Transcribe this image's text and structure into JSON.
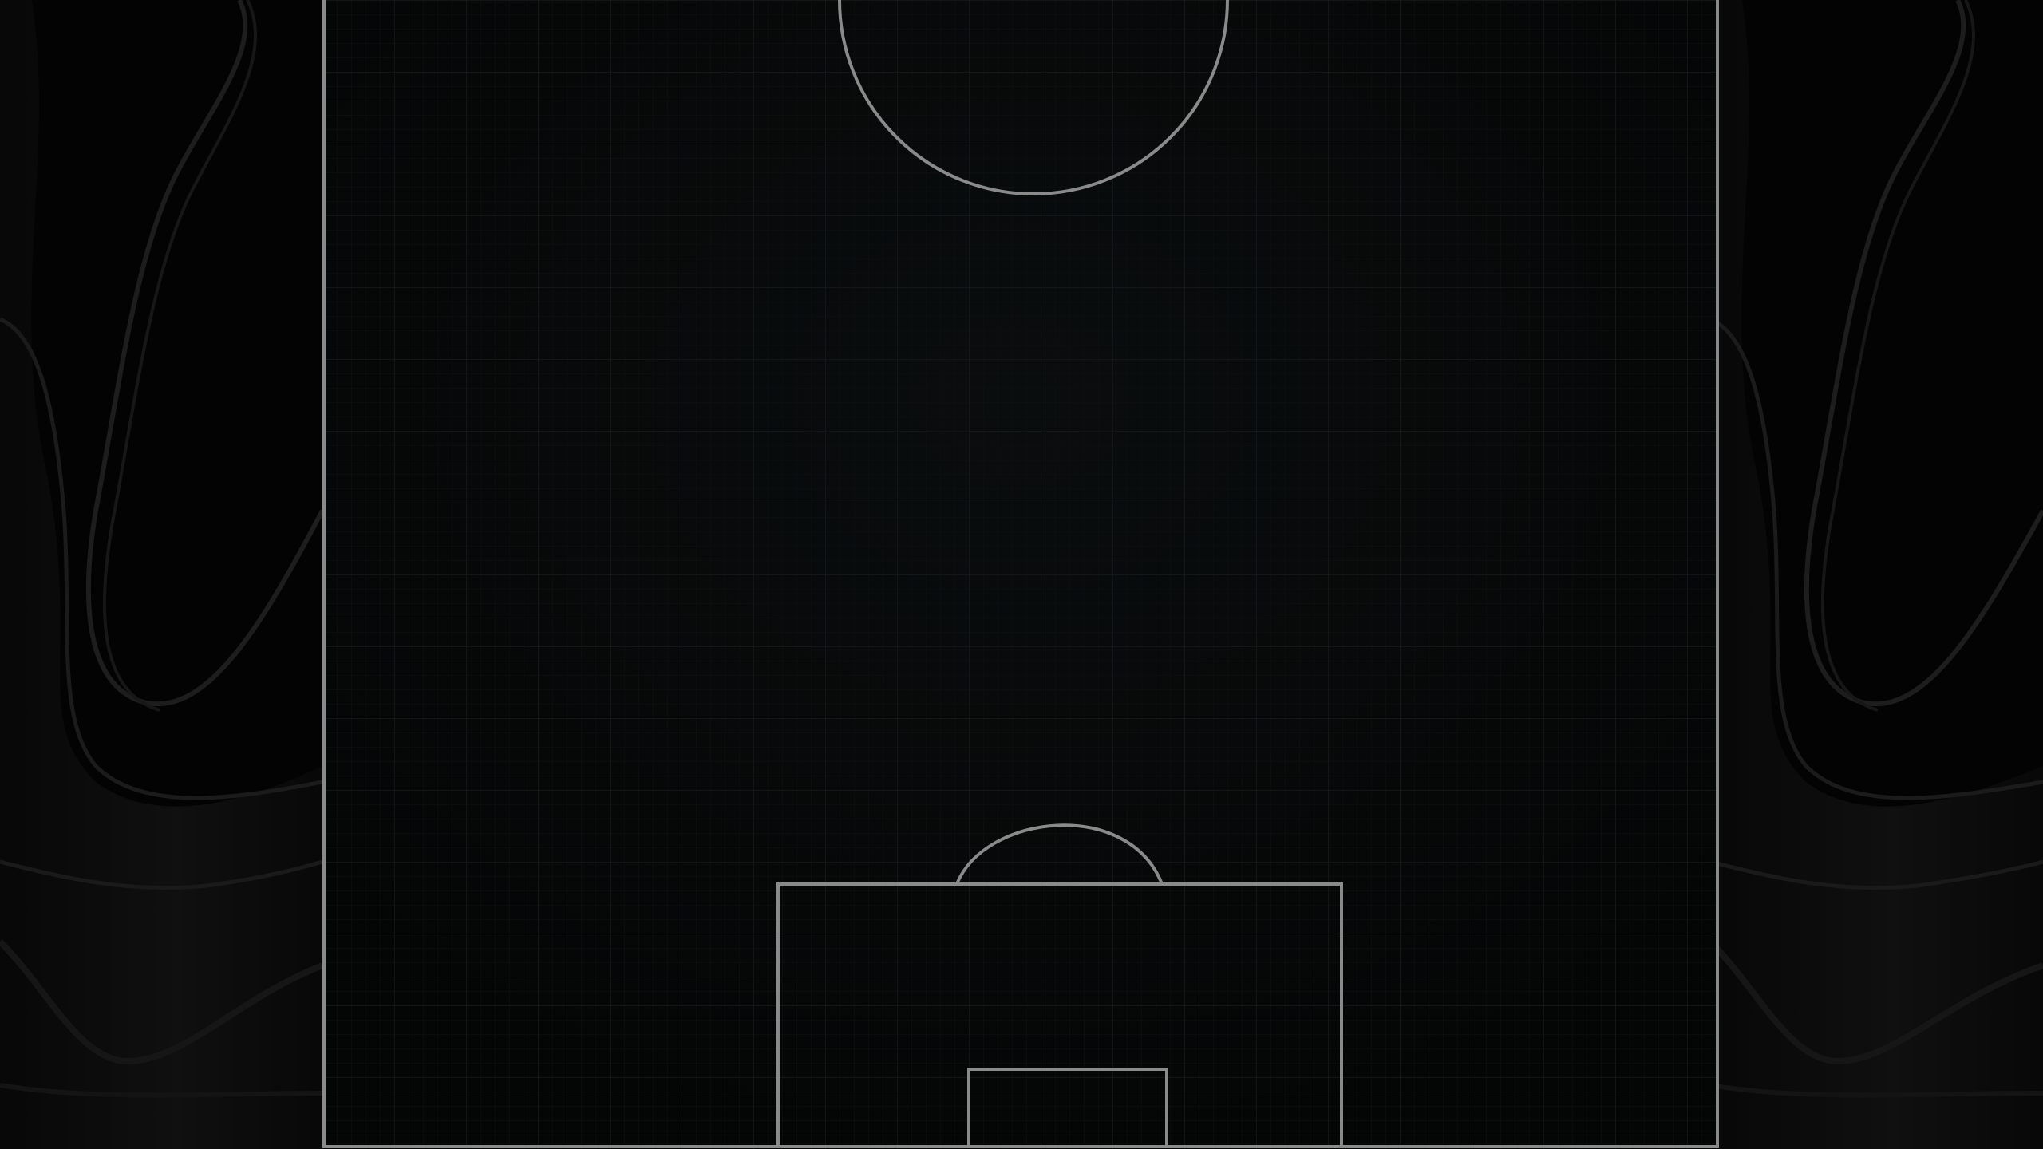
{
  "colors": {
    "background": "#000000",
    "pitch_fill": "#050505",
    "pitch_lines": "#8a8a8a",
    "grid_lines": "#14191b",
    "wave_fill": "#151515",
    "wave_stroke": "#1f1f1f"
  },
  "pitch": {
    "view": "half-pitch-vertical",
    "grid": true,
    "markings": [
      "touchlines",
      "center-circle",
      "penalty-area",
      "penalty-arc",
      "goal-area"
    ]
  }
}
